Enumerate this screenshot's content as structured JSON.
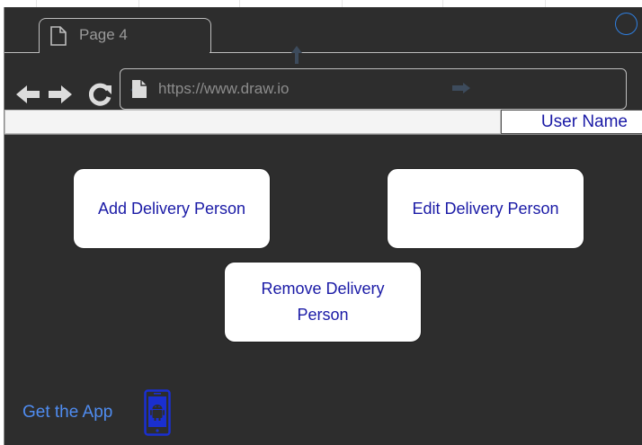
{
  "browser": {
    "tab": {
      "label": "Page 4",
      "icon": "page-icon"
    },
    "toolbar": {
      "back_icon": "arrow-left-icon",
      "forward_icon": "arrow-right-icon",
      "reload_icon": "reload-icon",
      "url": "https://www.draw.io"
    },
    "window_control_icon": "circle-icon"
  },
  "header": {
    "user_label": "User Name"
  },
  "main": {
    "buttons": [
      {
        "label": "Add Delivery Person"
      },
      {
        "label": "Edit Delivery Person"
      },
      {
        "label": "Remove Delivery Person"
      }
    ]
  },
  "footer": {
    "get_app_label": "Get the App",
    "app_icon": "android-phone-icon"
  },
  "colors": {
    "background": "#2d2d2d",
    "button_text": "#1a1aa6",
    "link": "#4f8cf0",
    "phone_blue": "#1a2fd0",
    "circle_accent": "#2f7fe0"
  }
}
